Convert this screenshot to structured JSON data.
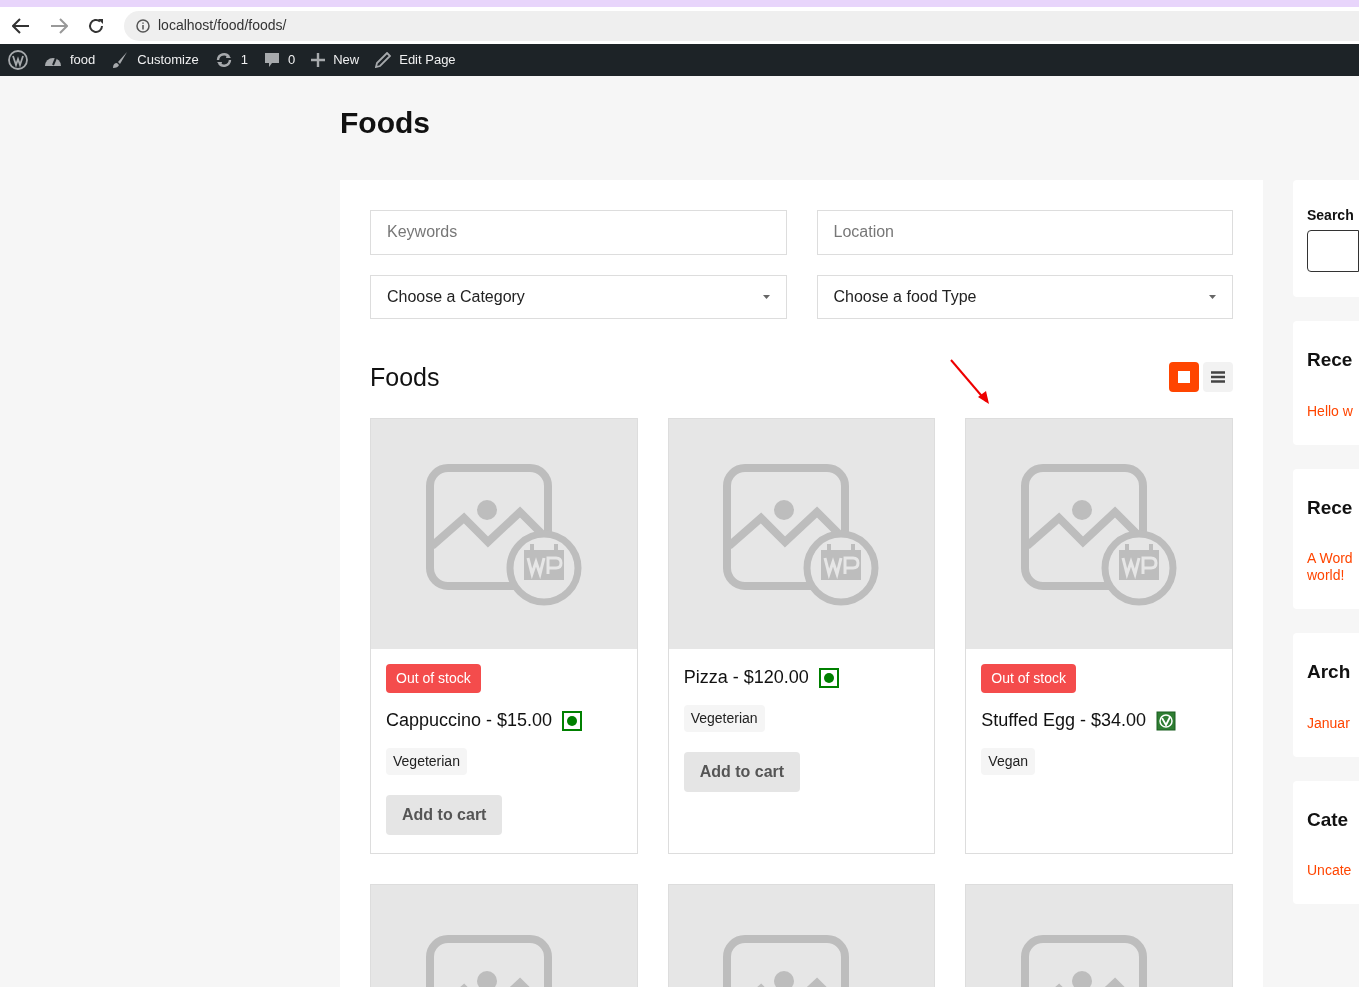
{
  "browser": {
    "url": "localhost/food/foods/"
  },
  "admin_bar": [
    {
      "kind": "logo"
    },
    {
      "kind": "site",
      "label": "food"
    },
    {
      "kind": "customize",
      "label": "Customize"
    },
    {
      "kind": "updates",
      "label": "1"
    },
    {
      "kind": "comments",
      "label": "0"
    },
    {
      "kind": "new",
      "label": "New"
    },
    {
      "kind": "edit",
      "label": "Edit Page"
    }
  ],
  "page_title": "Foods",
  "filters": {
    "keywords": {
      "placeholder": "Keywords"
    },
    "location": {
      "placeholder": "Location"
    },
    "category": {
      "value": "Choose a Category"
    },
    "food_type": {
      "value": "Choose a food Type"
    }
  },
  "section_title": "Foods",
  "view_toggle": [
    {
      "kind": "grid",
      "selected": true
    },
    {
      "kind": "list",
      "selected": false
    }
  ],
  "foods": [
    {
      "kind": "item",
      "badge": "Out of stock",
      "title": "Cappuccino - $15.00",
      "vegan": false,
      "tag": "Vegeterian",
      "button": "Add to cart"
    },
    {
      "kind": "item",
      "title": "Pizza - $120.00",
      "vegan": false,
      "tag": "Vegeterian",
      "button": "Add to cart"
    },
    {
      "kind": "item",
      "badge": "Out of stock",
      "title": "Stuffed Egg - $34.00",
      "vegan": true,
      "tag": "Vegan"
    },
    {
      "kind": "picture"
    },
    {
      "kind": "picture"
    },
    {
      "kind": "picture"
    }
  ],
  "sidebar": [
    {
      "kind": "search",
      "title": "Search"
    },
    {
      "kind": "links",
      "title": "Rece",
      "links": [
        "Hello w"
      ]
    },
    {
      "kind": "links",
      "title": "Rece",
      "links": [
        "A Word world!"
      ]
    },
    {
      "kind": "links",
      "title": "Arch",
      "links": [
        "Januar"
      ]
    },
    {
      "kind": "links",
      "title": "Cate",
      "links": [
        "Uncate"
      ]
    }
  ]
}
